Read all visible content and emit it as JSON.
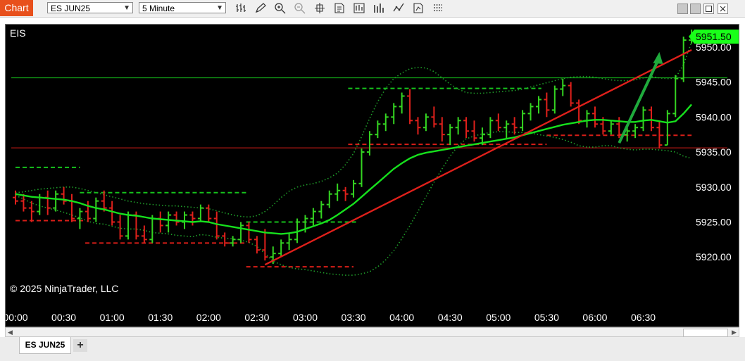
{
  "toolbar": {
    "chart_label": "Chart",
    "instrument_value": "ES JUN25",
    "interval_value": "5 Minute",
    "icons": [
      "bar-type-icon",
      "pencil-icon",
      "zoom-in-icon",
      "zoom-out-icon",
      "crosshair-icon",
      "properties-icon",
      "data-box-icon",
      "chart-style-icon",
      "indicators-icon",
      "strategies-icon",
      "templates-icon"
    ]
  },
  "window_controls": [
    "window-1-icon",
    "window-2-icon",
    "restore-icon",
    "close-icon"
  ],
  "chart": {
    "instrument_label": "EIS",
    "copyright": "© 2025 NinjaTrader, LLC",
    "current_price_label": "5951.50",
    "colors": {
      "background": "#000000",
      "up": "#34d421",
      "down": "#e0201b",
      "neutral": "#3d8fe3",
      "ma": "#16e01d",
      "price_badge": "#19ff19"
    }
  },
  "chart_data": {
    "type": "bar",
    "bar_style": "ohlc",
    "ylim": [
      5916.4,
      5951.6
    ],
    "y_ticks": [
      5950,
      5945,
      5940,
      5935,
      5930,
      5925,
      5920
    ],
    "y_tick_labels": [
      "5950.00",
      "5945.00",
      "5940.00",
      "5935.00",
      "5930.00",
      "5925.00",
      "5920.00"
    ],
    "x_tick_labels": [
      "00:00",
      "00:30",
      "01:00",
      "01:30",
      "02:00",
      "02:30",
      "03:00",
      "03:30",
      "04:00",
      "04:30",
      "05:00",
      "05:30",
      "06:00",
      "06:30"
    ],
    "bars_per_tick": 6,
    "ohlc": [
      [
        5928.5,
        5929.5,
        5927.5,
        5928.0
      ],
      [
        5928.0,
        5929.0,
        5926.5,
        5927.0
      ],
      [
        5927.0,
        5928.0,
        5925.0,
        5926.5
      ],
      [
        5926.5,
        5929.0,
        5926.0,
        5928.5
      ],
      [
        5928.5,
        5929.5,
        5926.0,
        5927.0
      ],
      [
        5927.0,
        5929.5,
        5926.5,
        5929.0
      ],
      [
        5929.0,
        5930.0,
        5927.5,
        5928.0
      ],
      [
        5928.0,
        5929.0,
        5925.0,
        5925.5
      ],
      [
        5925.5,
        5927.0,
        5924.0,
        5926.5
      ],
      [
        5926.5,
        5928.0,
        5925.0,
        5925.5
      ],
      [
        5925.5,
        5928.5,
        5925.0,
        5928.0
      ],
      [
        5928.0,
        5929.5,
        5926.5,
        5927.0
      ],
      [
        5927.0,
        5928.0,
        5924.5,
        5925.0
      ],
      [
        5925.0,
        5926.0,
        5922.5,
        5923.0
      ],
      [
        5923.0,
        5926.5,
        5922.5,
        5926.0
      ],
      [
        5926.0,
        5926.5,
        5922.5,
        5923.0
      ],
      [
        5923.0,
        5924.5,
        5922.0,
        5922.5
      ],
      [
        5922.5,
        5926.0,
        5922.0,
        5925.5
      ],
      [
        5925.5,
        5926.5,
        5923.5,
        5924.5
      ],
      [
        5924.5,
        5926.5,
        5923.5,
        5926.0
      ],
      [
        5926.0,
        5926.5,
        5924.5,
        5925.0
      ],
      [
        5925.0,
        5926.5,
        5924.0,
        5926.0
      ],
      [
        5926.0,
        5926.5,
        5924.5,
        5925.5
      ],
      [
        5925.5,
        5927.5,
        5925.0,
        5927.0
      ],
      [
        5927.0,
        5927.5,
        5925.0,
        5925.5
      ],
      [
        5925.5,
        5926.5,
        5922.5,
        5923.0
      ],
      [
        5923.0,
        5923.5,
        5921.5,
        5922.0
      ],
      [
        5922.0,
        5923.0,
        5921.5,
        5922.5
      ],
      [
        5922.5,
        5925.0,
        5922.0,
        5924.5
      ],
      [
        5924.5,
        5925.0,
        5922.0,
        5922.5
      ],
      [
        5922.5,
        5923.0,
        5920.5,
        5921.0
      ],
      [
        5921.0,
        5924.0,
        5919.5,
        5920.0
      ],
      [
        5920.0,
        5921.5,
        5919.0,
        5920.5
      ],
      [
        5920.5,
        5922.5,
        5920.0,
        5922.0
      ],
      [
        5922.0,
        5923.5,
        5921.0,
        5922.5
      ],
      [
        5922.5,
        5925.5,
        5922.0,
        5925.0
      ],
      [
        5925.0,
        5926.0,
        5923.5,
        5925.5
      ],
      [
        5925.5,
        5927.0,
        5924.5,
        5926.5
      ],
      [
        5926.5,
        5928.0,
        5925.5,
        5927.5
      ],
      [
        5927.5,
        5929.5,
        5927.0,
        5929.0
      ],
      [
        5929.0,
        5930.5,
        5928.0,
        5929.5
      ],
      [
        5929.5,
        5930.0,
        5928.0,
        5929.0
      ],
      [
        5929.0,
        5931.0,
        5928.5,
        5930.5
      ],
      [
        5930.5,
        5935.5,
        5930.0,
        5935.0
      ],
      [
        5935.0,
        5938.0,
        5934.5,
        5937.5
      ],
      [
        5937.5,
        5939.5,
        5937.0,
        5939.0
      ],
      [
        5939.0,
        5940.5,
        5938.0,
        5940.0
      ],
      [
        5940.0,
        5942.0,
        5939.0,
        5941.5
      ],
      [
        5941.5,
        5943.5,
        5940.5,
        5943.0
      ],
      [
        5943.0,
        5944.0,
        5939.0,
        5939.5
      ],
      [
        5939.5,
        5940.0,
        5937.5,
        5938.5
      ],
      [
        5938.5,
        5940.5,
        5938.0,
        5940.0
      ],
      [
        5940.0,
        5941.5,
        5938.5,
        5939.0
      ],
      [
        5939.0,
        5940.0,
        5936.5,
        5937.5
      ],
      [
        5937.5,
        5939.0,
        5936.0,
        5938.5
      ],
      [
        5938.5,
        5940.0,
        5937.5,
        5939.5
      ],
      [
        5939.5,
        5940.0,
        5937.0,
        5938.0
      ],
      [
        5938.0,
        5939.5,
        5936.5,
        5937.0
      ],
      [
        5937.0,
        5938.5,
        5936.0,
        5937.5
      ],
      [
        5937.5,
        5940.0,
        5937.0,
        5939.5
      ],
      [
        5939.5,
        5940.5,
        5938.0,
        5938.5
      ],
      [
        5938.5,
        5939.5,
        5937.0,
        5939.0
      ],
      [
        5939.0,
        5940.0,
        5937.5,
        5938.5
      ],
      [
        5938.5,
        5941.0,
        5938.0,
        5940.5
      ],
      [
        5940.5,
        5942.0,
        5939.5,
        5941.5
      ],
      [
        5941.5,
        5943.0,
        5940.5,
        5942.5
      ],
      [
        5942.5,
        5943.5,
        5940.0,
        5941.0
      ],
      [
        5941.0,
        5944.5,
        5940.5,
        5944.0
      ],
      [
        5944.0,
        5945.5,
        5943.0,
        5944.5
      ],
      [
        5944.5,
        5945.0,
        5941.5,
        5942.0
      ],
      [
        5942.0,
        5942.5,
        5939.0,
        5939.5
      ],
      [
        5939.5,
        5941.0,
        5938.5,
        5940.5
      ],
      [
        5940.5,
        5941.5,
        5938.5,
        5939.0
      ],
      [
        5939.0,
        5940.0,
        5937.5,
        5938.0
      ],
      [
        5938.0,
        5939.5,
        5937.5,
        5939.0
      ],
      [
        5939.0,
        5940.0,
        5937.0,
        5937.5
      ],
      [
        5937.5,
        5938.5,
        5936.5,
        5938.0
      ],
      [
        5938.0,
        5939.0,
        5937.0,
        5938.5
      ],
      [
        5938.5,
        5941.5,
        5938.0,
        5941.0
      ],
      [
        5941.0,
        5941.5,
        5938.0,
        5938.5
      ],
      [
        5938.5,
        5939.5,
        5935.5,
        5936.0
      ],
      [
        5936.0,
        5941.0,
        5936.0,
        5940.5
      ],
      [
        5940.5,
        5946.0,
        5940.0,
        5945.5
      ],
      [
        5945.5,
        5951.5,
        5945.0,
        5951.0
      ],
      [
        5951.0,
        5952.5,
        5950.5,
        5951.5
      ]
    ],
    "moving_average": [
      5929.0,
      5928.8,
      5928.6,
      5928.5,
      5928.4,
      5928.3,
      5928.2,
      5928.0,
      5927.7,
      5927.3,
      5927.0,
      5926.8,
      5926.5,
      5926.2,
      5926.0,
      5925.9,
      5925.7,
      5925.5,
      5925.4,
      5925.3,
      5925.2,
      5925.1,
      5925.0,
      5925.1,
      5925.0,
      5924.7,
      5924.5,
      5924.3,
      5924.1,
      5923.9,
      5923.7,
      5923.5,
      5923.4,
      5923.3,
      5923.4,
      5923.6,
      5924.0,
      5924.4,
      5924.8,
      5925.3,
      5926.0,
      5926.8,
      5927.6,
      5928.6,
      5929.6,
      5930.6,
      5931.6,
      5932.6,
      5933.4,
      5934.1,
      5934.6,
      5934.9,
      5935.1,
      5935.3,
      5935.5,
      5935.7,
      5935.9,
      5936.1,
      5936.3,
      5936.5,
      5936.7,
      5936.9,
      5937.1,
      5937.4,
      5937.7,
      5938.0,
      5938.3,
      5938.6,
      5938.9,
      5939.1,
      5939.3,
      5939.5,
      5939.6,
      5939.6,
      5939.5,
      5939.4,
      5939.3,
      5939.3,
      5939.5,
      5939.6,
      5939.4,
      5939.2,
      5939.4,
      5940.5,
      5941.8
    ],
    "upper_band": [
      5929.2,
      5929.3,
      5929.5,
      5929.7,
      5929.8,
      5929.9,
      5930.0,
      5930.0,
      5929.8,
      5929.5,
      5929.2,
      5928.9,
      5928.6,
      5928.3,
      5928.0,
      5927.8,
      5927.6,
      5927.5,
      5927.4,
      5927.3,
      5927.3,
      5927.2,
      5927.1,
      5927.0,
      5926.9,
      5926.6,
      5926.3,
      5926.0,
      5925.8,
      5925.7,
      5925.9,
      5926.5,
      5927.4,
      5928.5,
      5929.4,
      5930.0,
      5930.3,
      5930.5,
      5930.8,
      5931.3,
      5932.0,
      5933.2,
      5934.8,
      5937.2,
      5939.8,
      5942.2,
      5944.1,
      5945.5,
      5946.3,
      5946.9,
      5947.1,
      5947.0,
      5946.5,
      5945.6,
      5944.7,
      5944.0,
      5943.5,
      5943.4,
      5943.4,
      5943.5,
      5943.6,
      5943.7,
      5943.8,
      5944.0,
      5944.3,
      5944.6,
      5944.9,
      5945.2,
      5945.5,
      5945.7,
      5945.8,
      5945.8,
      5945.7,
      5945.5,
      5945.3,
      5945.2,
      5945.2,
      5945.3,
      5945.6,
      5945.8,
      5945.6,
      5945.5,
      5945.6,
      5947.5,
      5950.7
    ],
    "lower_band": [
      5928.8,
      5928.3,
      5927.7,
      5927.3,
      5927.0,
      5926.7,
      5926.4,
      5926.0,
      5925.6,
      5925.1,
      5924.8,
      5924.7,
      5924.4,
      5924.1,
      5924.0,
      5924.0,
      5923.8,
      5923.5,
      5923.4,
      5923.3,
      5923.1,
      5923.0,
      5922.9,
      5923.2,
      5923.1,
      5922.8,
      5922.7,
      5922.6,
      5922.4,
      5922.1,
      5921.5,
      5920.5,
      5919.4,
      5918.9,
      5918.5,
      5918.3,
      5918.2,
      5918.0,
      5917.8,
      5917.6,
      5917.5,
      5917.4,
      5917.4,
      5917.6,
      5917.9,
      5918.6,
      5919.6,
      5920.9,
      5922.6,
      5924.5,
      5926.5,
      5928.6,
      5930.7,
      5932.6,
      5934.4,
      5935.9,
      5936.9,
      5937.3,
      5937.6,
      5937.8,
      5937.9,
      5937.9,
      5937.8,
      5937.8,
      5937.7,
      5937.5,
      5937.3,
      5937.1,
      5936.8,
      5936.4,
      5935.9,
      5935.7,
      5935.7,
      5935.9,
      5935.9,
      5935.6,
      5935.4,
      5935.3,
      5935.4,
      5935.4,
      5935.3,
      5935.2,
      5935.0,
      5934.4,
      5934.1
    ],
    "horizontal_lines": [
      {
        "price": 5945.6,
        "style": "solid",
        "color": "#16c21c",
        "from": 0,
        "to": 84
      },
      {
        "price": 5935.6,
        "style": "solid",
        "color": "#d81e18",
        "from": 0,
        "to": 84
      }
    ],
    "level_segments": [
      {
        "price": 5932.8,
        "style": "dashed",
        "color": "#16c21c",
        "from": 0,
        "to": 12
      },
      {
        "price": 5929.2,
        "style": "dashed",
        "color": "#16c21c",
        "from": 12,
        "to": 43
      },
      {
        "price": 5925.0,
        "style": "dashed",
        "color": "#16c21c",
        "from": 43,
        "to": 64
      },
      {
        "price": 5944.1,
        "style": "dashed",
        "color": "#16c21c",
        "from": 62,
        "to": 98
      },
      {
        "price": 5925.2,
        "style": "dashed",
        "color": "#d81e18",
        "from": 0,
        "to": 13
      },
      {
        "price": 5922.0,
        "style": "dashed",
        "color": "#d81e18",
        "from": 13,
        "to": 43
      },
      {
        "price": 5918.6,
        "style": "dashed",
        "color": "#d81e18",
        "from": 43,
        "to": 63
      },
      {
        "price": 5936.1,
        "style": "dashed",
        "color": "#d81e18",
        "from": 62,
        "to": 99
      },
      {
        "price": 5937.4,
        "style": "dashed",
        "color": "#d81e18",
        "from": 99,
        "to": 126
      },
      {
        "price": 5950.9,
        "style": "dashed",
        "color": "#16c21c",
        "from": 126,
        "to": 132
      }
    ],
    "trend_line": {
      "from": [
        31,
        5918.9
      ],
      "to": [
        84,
        5949.6
      ],
      "color": "#e0201b"
    },
    "arrow": {
      "from": [
        75,
        5936.3
      ],
      "to": [
        80,
        5949.3
      ],
      "color": "#1faa3c"
    }
  },
  "scrollbar": {
    "left_arrow": "scroll-left-icon",
    "right_arrow": "scroll-right-icon"
  },
  "tabs": {
    "active_label": "ES JUN25",
    "add_label": "+"
  }
}
